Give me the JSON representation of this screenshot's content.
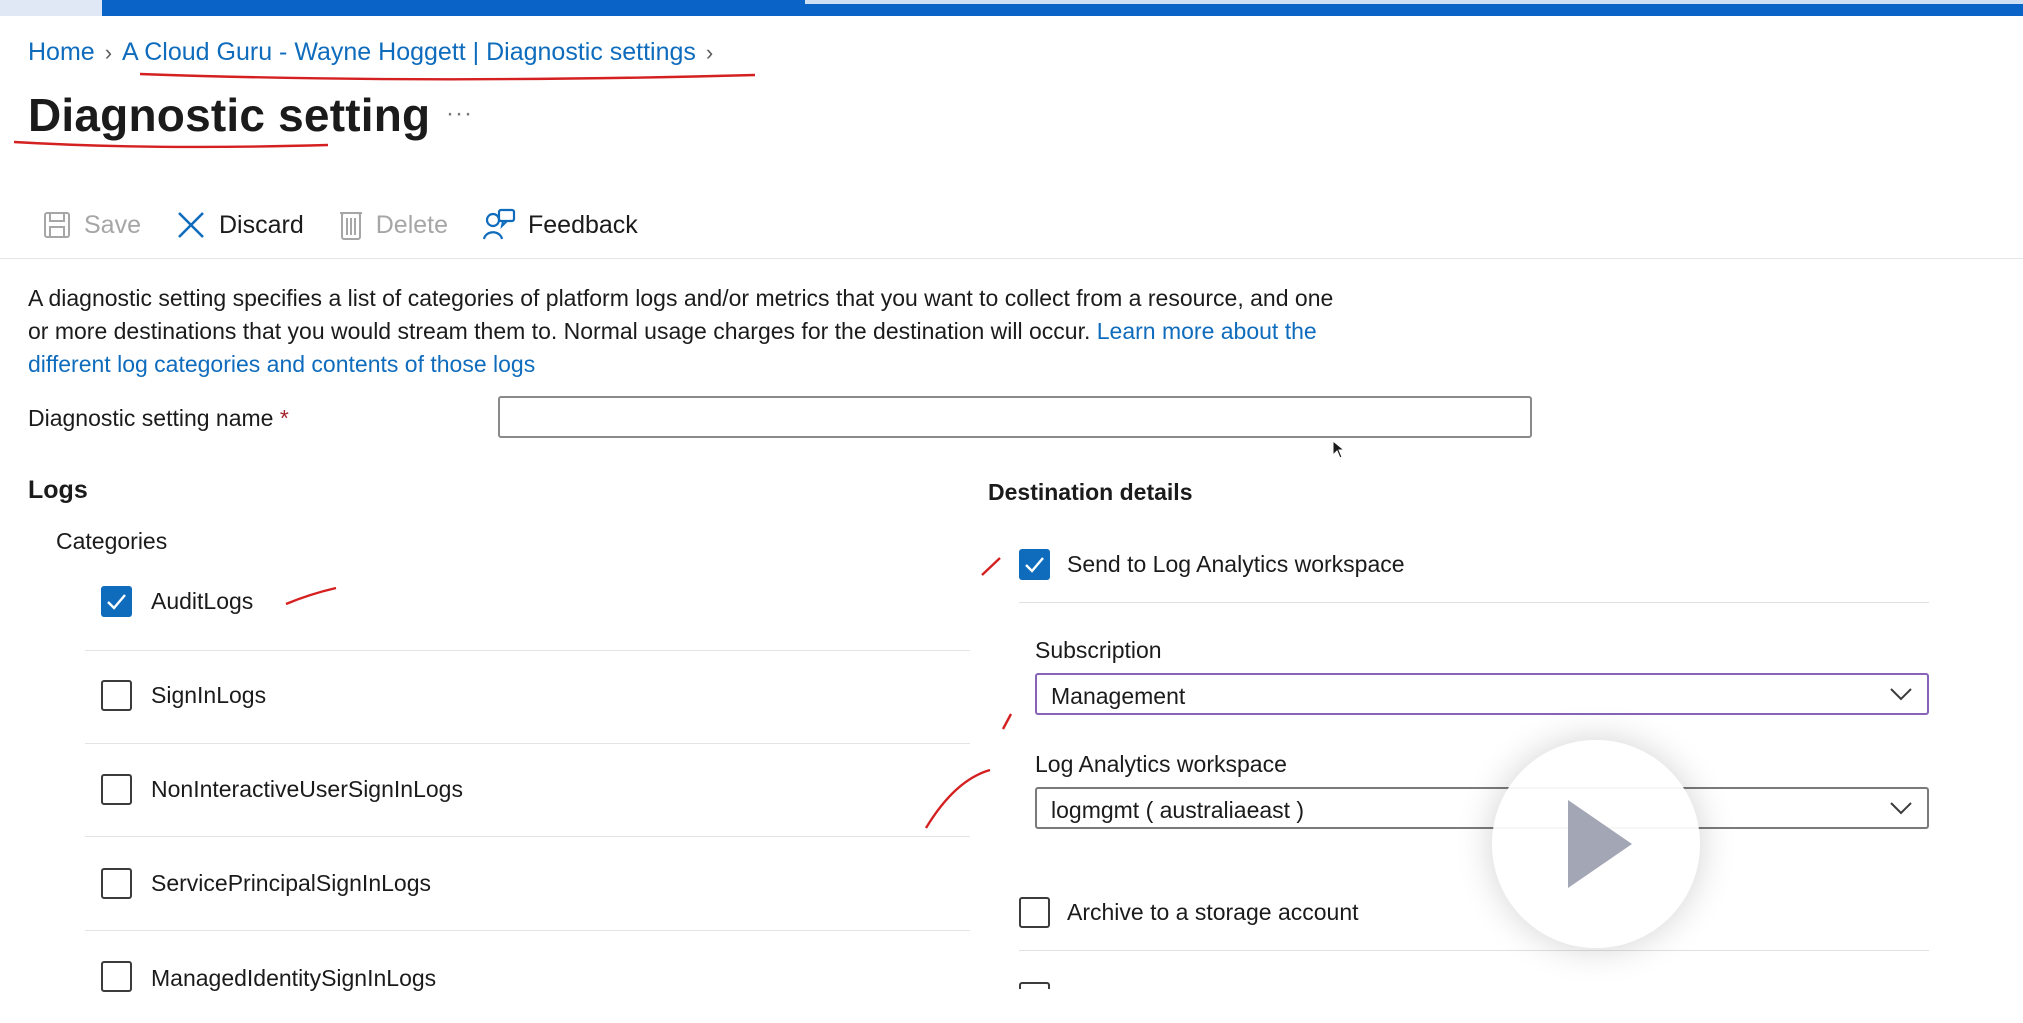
{
  "breadcrumb": {
    "home": "Home",
    "parent": "A Cloud Guru - Wayne Hoggett | Diagnostic settings"
  },
  "page": {
    "title": "Diagnostic setting",
    "more": "···"
  },
  "toolbar": {
    "save": "Save",
    "discard": "Discard",
    "delete": "Delete",
    "feedback": "Feedback"
  },
  "description": {
    "text": "A diagnostic setting specifies a list of categories of platform logs and/or metrics that you want to collect from a resource, and one or more destinations that you would stream them to. Normal usage charges for the destination will occur. ",
    "link": "Learn more about the different log categories and contents of those logs"
  },
  "form": {
    "name_label": "Diagnostic setting name",
    "required_mark": "*",
    "name_value": ""
  },
  "logs": {
    "heading": "Logs",
    "categories_label": "Categories",
    "categories": [
      {
        "label": "AuditLogs",
        "checked": true
      },
      {
        "label": "SignInLogs",
        "checked": false
      },
      {
        "label": "NonInteractiveUserSignInLogs",
        "checked": false
      },
      {
        "label": "ServicePrincipalSignInLogs",
        "checked": false
      },
      {
        "label": "ManagedIdentitySignInLogs",
        "checked": false
      }
    ]
  },
  "destination": {
    "heading": "Destination details",
    "send_to_log_analytics": {
      "label": "Send to Log Analytics workspace",
      "checked": true
    },
    "subscription": {
      "label": "Subscription",
      "value": "Management"
    },
    "workspace": {
      "label": "Log Analytics workspace",
      "value": "logmgmt ( australiaeast )"
    },
    "archive": {
      "label": "Archive to a storage account",
      "checked": false
    }
  },
  "colors": {
    "accent": "#0f6cbd",
    "top_bar": "#0a64c8",
    "annotation": "#d42020",
    "focus_border": "#8764b8"
  },
  "icons": [
    "save-icon",
    "close-icon",
    "trash-icon",
    "feedback-icon",
    "check-icon",
    "chevron-down-icon",
    "play-icon"
  ]
}
